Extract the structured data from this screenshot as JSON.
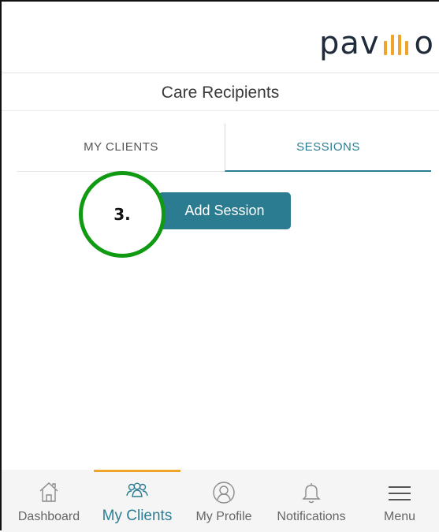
{
  "header": {
    "logo_left": "pav",
    "logo_right": "o"
  },
  "page": {
    "title": "Care Recipients"
  },
  "tabs": [
    {
      "label": "MY CLIENTS",
      "active": false
    },
    {
      "label": "SESSIONS",
      "active": true
    }
  ],
  "sessions": {
    "add_label": "Add Session"
  },
  "annotation": {
    "step": "3."
  },
  "bottom_nav": [
    {
      "label": "Dashboard",
      "icon": "home-icon",
      "active": false
    },
    {
      "label": "My Clients",
      "icon": "people-icon",
      "active": true
    },
    {
      "label": "My Profile",
      "icon": "profile-icon",
      "active": false
    },
    {
      "label": "Notifications",
      "icon": "bell-icon",
      "active": false
    },
    {
      "label": "Menu",
      "icon": "hamburger-icon",
      "active": false
    }
  ],
  "colors": {
    "accent": "#2b7b91",
    "brand_orange": "#f0a52a",
    "annotation_green": "#0f9a12"
  }
}
